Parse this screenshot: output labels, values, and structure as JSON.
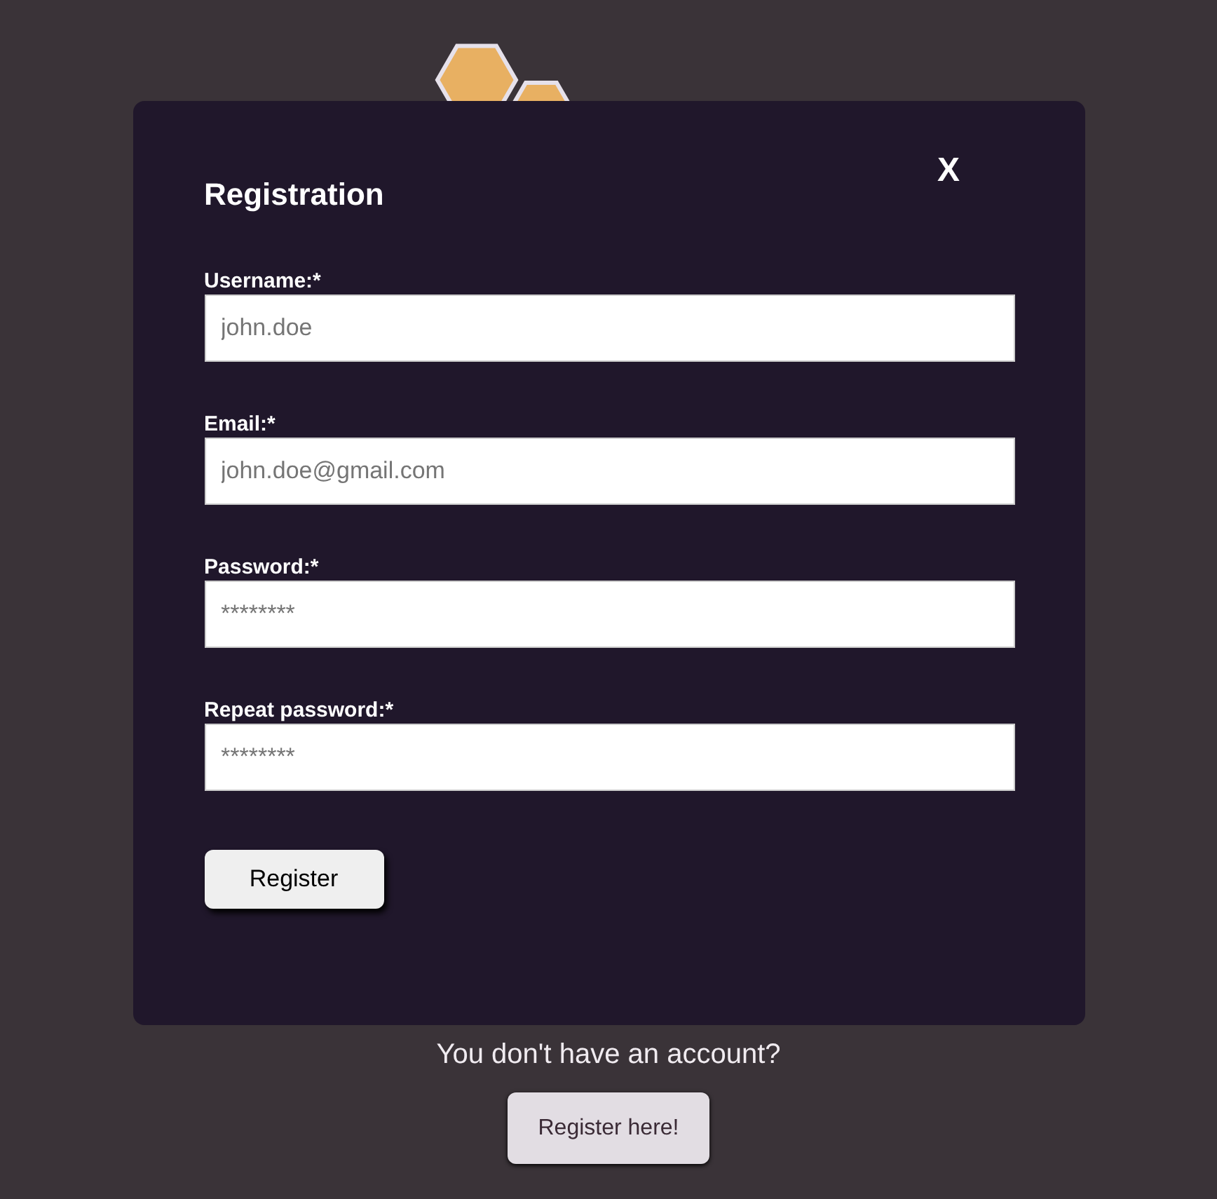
{
  "dialog": {
    "title": "Registration",
    "close": "X",
    "fields": [
      {
        "label": "Username:*",
        "placeholder": "john.doe"
      },
      {
        "label": "Email:*",
        "placeholder": "john.doe@gmail.com"
      },
      {
        "label": "Password:*",
        "placeholder": "********"
      },
      {
        "label": "Repeat password:*",
        "placeholder": "********"
      }
    ],
    "submit": "Register"
  },
  "prompt": "You don't have an account?",
  "register_link": "Register here!"
}
